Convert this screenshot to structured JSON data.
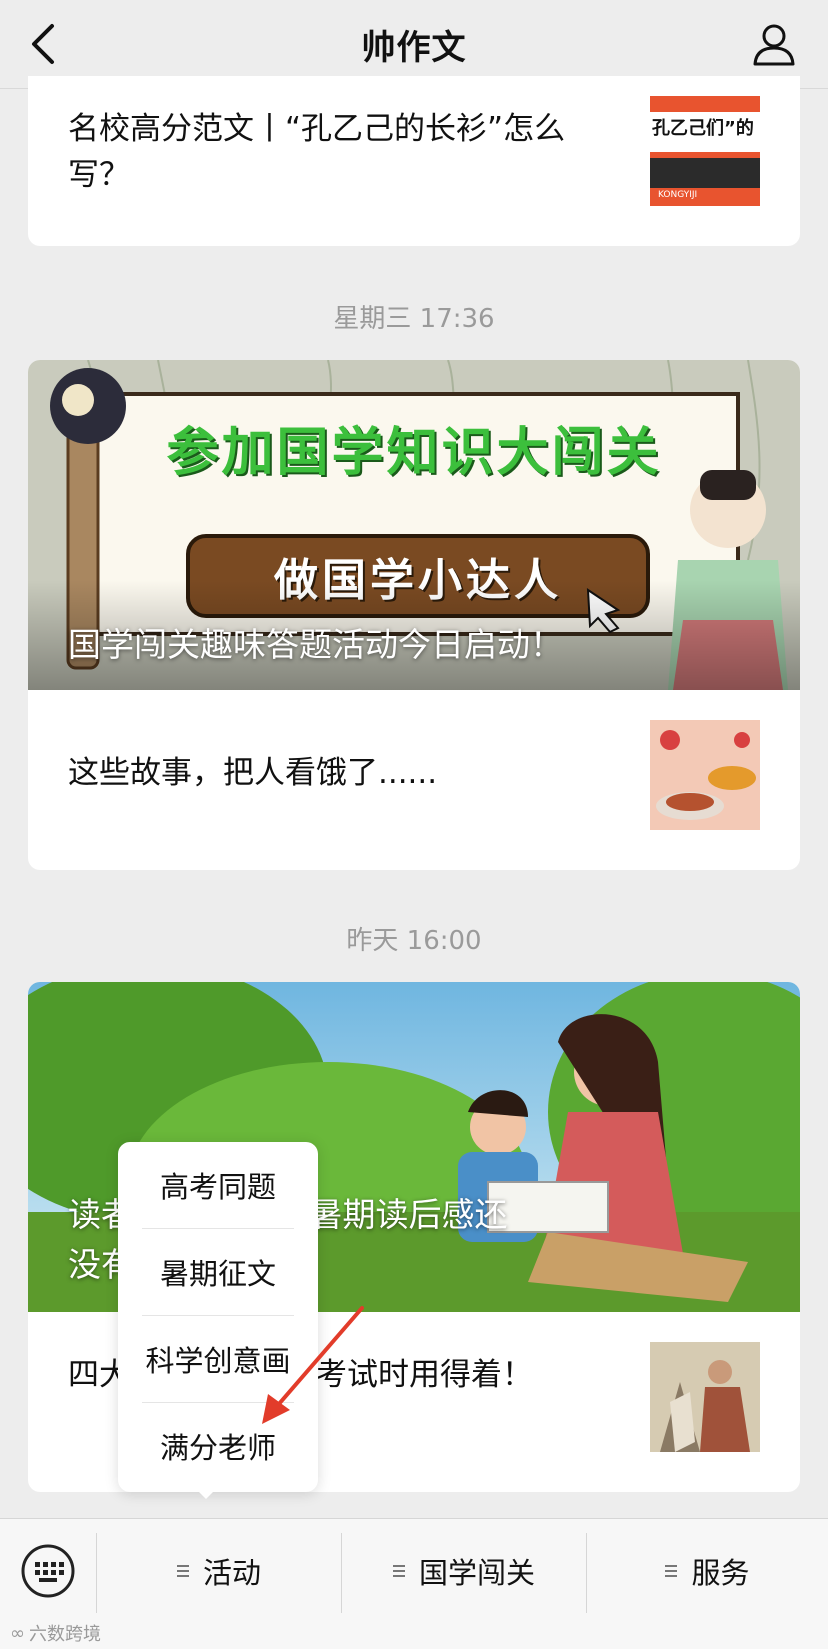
{
  "header": {
    "title": "帅作文"
  },
  "feed": {
    "article_top": {
      "title": "名校高分范文丨“孔乙己的长衫”怎么写？",
      "thumb_text": "孔乙己们”的",
      "thumb_footer": "KONGYIJI"
    },
    "ts1": "星期三 17:36",
    "banner1": {
      "headline": "参加国学知识大闯关",
      "sub_button": "做国学小达人",
      "caption": "国学闯关趣味答题活动今日启动！"
    },
    "article2": {
      "title": "这些故事，把人看饿了......"
    },
    "ts2": "昨天 16:00",
    "banner2": {
      "caption_line1": "读者 老师布置的暑期读后感还",
      "caption_line2": "没有 来 ➔"
    },
    "article3": {
      "title": "四大名著阅解析，考试时用得着！"
    }
  },
  "popup_menu": {
    "items": [
      "高考同题",
      "暑期征文",
      "科学创意画",
      "满分老师"
    ]
  },
  "bottom_menu": {
    "tabs": [
      "活动",
      "国学闯关",
      "服务"
    ]
  },
  "watermark": "六数跨境",
  "colors": {
    "accent_arrow": "#e23c2a",
    "banner1_green": "#3cbf3c",
    "banner1_button": "#7a4a22"
  }
}
